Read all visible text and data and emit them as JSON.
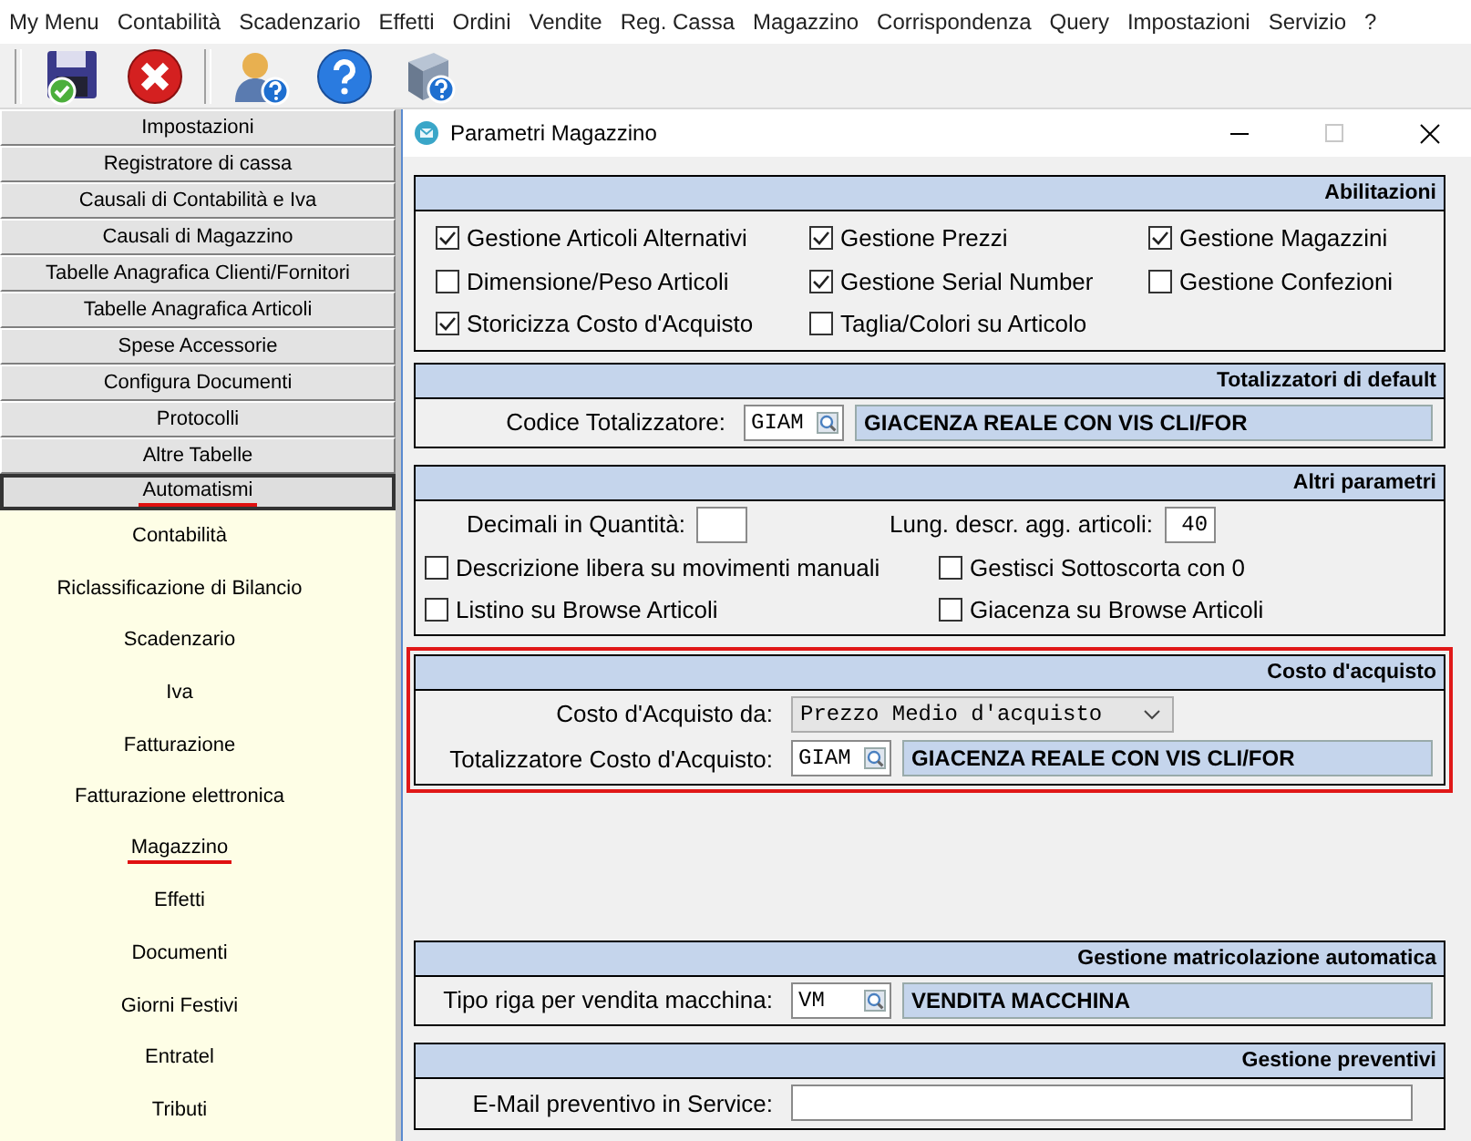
{
  "menu_bar": {
    "items": [
      "My Menu",
      "Contabilità",
      "Scadenzario",
      "Effetti",
      "Ordini",
      "Vendite",
      "Reg. Cassa",
      "Magazzino",
      "Corrispondenza",
      "Query",
      "Impostazioni",
      "Servizio",
      "?"
    ]
  },
  "sidebar": {
    "groups": [
      {
        "label": "Impostazioni",
        "selected": false,
        "highlighted": false
      },
      {
        "label": "Registratore di cassa",
        "selected": false,
        "highlighted": false
      },
      {
        "label": "Causali di Contabilità e Iva",
        "selected": false,
        "highlighted": false
      },
      {
        "label": "Causali di Magazzino",
        "selected": false,
        "highlighted": false
      },
      {
        "label": "Tabelle Anagrafica Clienti/Fornitori",
        "selected": false,
        "highlighted": false
      },
      {
        "label": "Tabelle Anagrafica Articoli",
        "selected": false,
        "highlighted": false
      },
      {
        "label": "Spese Accessorie",
        "selected": false,
        "highlighted": false
      },
      {
        "label": "Configura Documenti",
        "selected": false,
        "highlighted": false
      },
      {
        "label": "Protocolli",
        "selected": false,
        "highlighted": false
      },
      {
        "label": "Altre Tabelle",
        "selected": false,
        "highlighted": false
      },
      {
        "label": "Automatismi",
        "selected": true,
        "highlighted": true
      }
    ],
    "items": [
      {
        "label": "Contabilità",
        "highlighted": false
      },
      {
        "label": "Riclassificazione di Bilancio",
        "highlighted": false
      },
      {
        "label": "Scadenzario",
        "highlighted": false
      },
      {
        "label": "Iva",
        "highlighted": false
      },
      {
        "label": "Fatturazione",
        "highlighted": false
      },
      {
        "label": "Fatturazione elettronica",
        "highlighted": false
      },
      {
        "label": "Magazzino",
        "highlighted": true
      },
      {
        "label": "Effetti",
        "highlighted": false
      },
      {
        "label": "Documenti",
        "highlighted": false
      },
      {
        "label": "Giorni Festivi",
        "highlighted": false
      },
      {
        "label": "Entratel",
        "highlighted": false
      },
      {
        "label": "Tributi",
        "highlighted": false
      }
    ]
  },
  "dialog": {
    "title": "Parametri Magazzino",
    "sections": [
      {
        "title": "Abilitazioni",
        "kind": "checks",
        "highlighted": false,
        "items": [
          {
            "kind": "check",
            "label": "Gestione Articoli Alternativi",
            "checked": true
          },
          {
            "kind": "check",
            "label": "Gestione Prezzi",
            "checked": true
          },
          {
            "kind": "check",
            "label": "Gestione Magazzini",
            "checked": true
          },
          {
            "kind": "check",
            "label": "Dimensione/Peso Articoli",
            "checked": false
          },
          {
            "kind": "check",
            "label": "Gestione Serial Number",
            "checked": true
          },
          {
            "kind": "check",
            "label": "Gestione Confezioni",
            "checked": false
          },
          {
            "kind": "check",
            "label": "Storicizza Costo d'Acquisto",
            "checked": true
          },
          {
            "kind": "check",
            "label": "Taglia/Colori su Articolo",
            "checked": false
          }
        ]
      },
      {
        "title": "Totalizzatori di default",
        "kind": "form",
        "highlighted": false,
        "items": [
          {
            "kind": "lookup",
            "label": "Codice Totalizzatore:",
            "code": "GIAM",
            "description": "GIACENZA REALE CON VIS CLI/FOR"
          }
        ]
      },
      {
        "title": "Altri parametri",
        "kind": "pairs",
        "highlighted": false,
        "items": [
          {
            "kind": "number",
            "label": "Decimali in Quantità:"
          },
          {
            "kind": "number",
            "label": "Lung. descr. agg. articoli:",
            "value": "40"
          },
          {
            "kind": "check",
            "label": "Descrizione libera su movimenti manuali",
            "checked": false
          },
          {
            "kind": "check",
            "label": "Gestisci Sottoscorta con 0",
            "checked": false
          },
          {
            "kind": "check",
            "label": "Listino su Browse Articoli",
            "checked": false
          },
          {
            "kind": "check",
            "label": "Giacenza su Browse Articoli",
            "checked": false
          }
        ]
      },
      {
        "title": "Costo d'acquisto",
        "kind": "form",
        "highlighted": true,
        "items": [
          {
            "kind": "dropdown",
            "label": "Costo d'Acquisto da:",
            "value": "Prezzo Medio d'acquisto"
          },
          {
            "kind": "lookup",
            "label": "Totalizzatore Costo d'Acquisto:",
            "code": "GIAM",
            "description": "GIACENZA REALE CON VIS CLI/FOR"
          }
        ]
      },
      {
        "title": "Gestione matricolazione automatica",
        "kind": "form",
        "highlighted": false,
        "items": [
          {
            "kind": "lookup",
            "label": "Tipo riga per vendita macchina:",
            "code": "VM",
            "description": "VENDITA MACCHINA"
          }
        ]
      },
      {
        "title": "Gestione preventivi",
        "kind": "form",
        "highlighted": false,
        "items": [
          {
            "kind": "text",
            "label": "E-Mail preventivo in Service:"
          }
        ]
      }
    ]
  }
}
